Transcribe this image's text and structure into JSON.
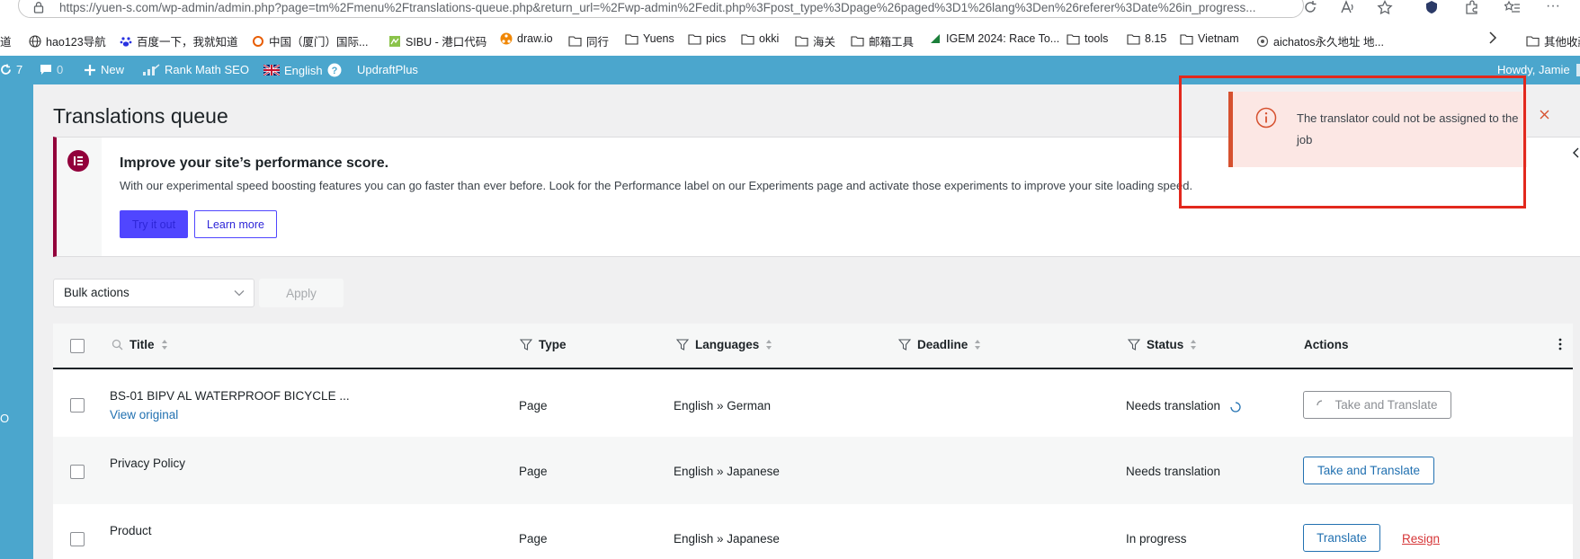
{
  "browser": {
    "url": "https://yuen-s.com/wp-admin/admin.php?page=tm%2Fmenu%2Ftranslations-queue.php&return_url=%2Fwp-admin%2Fedit.php%3Fpost_type%3Dpage%26paged%3D1%26lang%3Den%26referer%3Date%26in_progress..."
  },
  "bookmarks": [
    {
      "label": "道",
      "icon": "none"
    },
    {
      "label": "hao123导航",
      "icon": "globe-icon"
    },
    {
      "label": "百度一下，我就知道",
      "icon": "baidu-icon"
    },
    {
      "label": "中国（厦门）国际...",
      "icon": "site-icon"
    },
    {
      "label": "SIBU - 港口代码",
      "icon": "site-icon"
    },
    {
      "label": "draw.io",
      "icon": "drawio-icon"
    },
    {
      "label": "同行",
      "icon": "folder-icon"
    },
    {
      "label": "Yuens",
      "icon": "folder-icon"
    },
    {
      "label": "pics",
      "icon": "folder-icon"
    },
    {
      "label": "okki",
      "icon": "folder-icon"
    },
    {
      "label": "海关",
      "icon": "folder-icon"
    },
    {
      "label": "邮箱工具",
      "icon": "folder-icon"
    },
    {
      "label": "IGEM 2024: Race To...",
      "icon": "site-icon"
    },
    {
      "label": "tools",
      "icon": "folder-icon"
    },
    {
      "label": "8.15",
      "icon": "folder-icon"
    },
    {
      "label": "Vietnam",
      "icon": "folder-icon"
    },
    {
      "label": "aichatos永久地址 地...",
      "icon": "site-icon"
    },
    {
      "label": "其他收藏",
      "icon": "folder-icon"
    }
  ],
  "adminbar": {
    "updates_count": "7",
    "comments_count": "0",
    "new_label": "New",
    "rankmath_label": "Rank Math SEO",
    "language_label": "English",
    "updraft_label": "UpdraftPlus",
    "howdy": "Howdy, Jamie"
  },
  "sidebar": {
    "truncated_label": "O"
  },
  "page": {
    "title": "Translations queue"
  },
  "notice": {
    "icon_text": "E",
    "title": "Improve your site’s performance score.",
    "description": "With our experimental speed boosting features you can go faster than ever before. Look for the Performance label on our Experiments page and activate those experiments to improve your site loading speed.",
    "try_label": "Try it out",
    "learn_label": "Learn more"
  },
  "bulk": {
    "selected": "Bulk actions",
    "apply_label": "Apply"
  },
  "table": {
    "headers": {
      "title": "Title",
      "type": "Type",
      "languages": "Languages",
      "deadline": "Deadline",
      "status": "Status",
      "actions": "Actions"
    },
    "rows": [
      {
        "title": "BS-01 BIPV AL WATERPROOF BICYCLE ...",
        "sublink": "View original",
        "type": "Page",
        "languages": "English » German",
        "status": "Needs translation",
        "action": "Take and Translate"
      },
      {
        "title": "Privacy Policy",
        "type": "Page",
        "languages": "English » Japanese",
        "status": "Needs translation",
        "action": "Take and Translate"
      },
      {
        "title": "Product",
        "type": "Page",
        "languages": "English » Japanese",
        "status": "In progress",
        "action": "Translate",
        "secondary_action": "Resign"
      }
    ]
  },
  "toast": {
    "message": "The translator could not be assigned to the job"
  },
  "colors": {
    "admin_bar": "#4ba6cd",
    "toast_bg": "#fce7e4",
    "toast_accent": "#d6512f",
    "highlight_box": "#e2281d",
    "elementor": "#92003b",
    "button_purple": "#5046ff",
    "wp_link": "#2271b1",
    "resign": "#d63638"
  }
}
